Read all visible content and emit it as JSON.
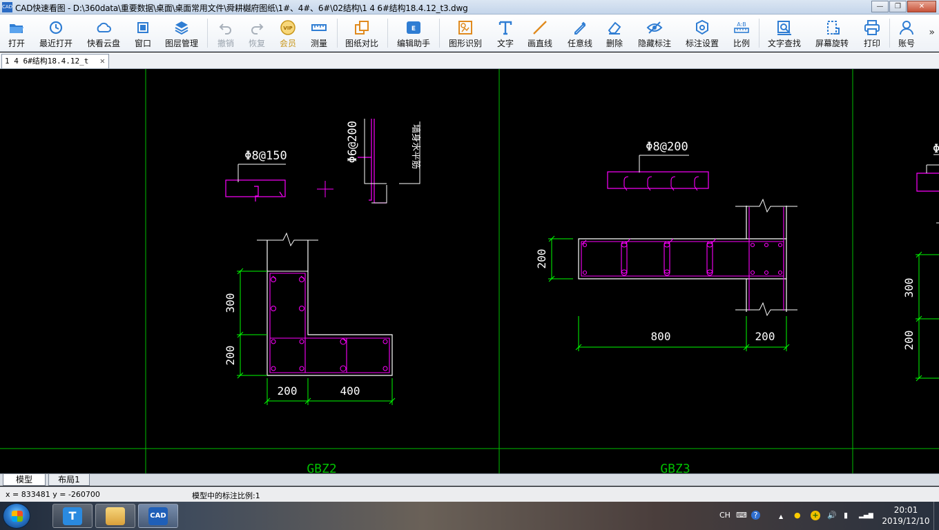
{
  "window": {
    "title": "CAD快速看图 - D:\\360data\\重要数据\\桌面\\桌面常用文件\\舜耕樾府图纸\\1#、4#、6#\\02结构\\1 4 6#结构18.4.12_t3.dwg",
    "icon_text": "CAD",
    "minimize": "—",
    "maximize": "❐",
    "close": "✕"
  },
  "toolbar": {
    "items": [
      {
        "label": "打开",
        "icon": "open-folder-icon",
        "color": "#2f7dd3"
      },
      {
        "label": "最近打开",
        "icon": "recent-history-icon",
        "color": "#2f7dd3"
      },
      {
        "label": "快看云盘",
        "icon": "cloud-icon",
        "color": "#2f7dd3"
      },
      {
        "label": "窗口",
        "icon": "window-icon",
        "color": "#2f7dd3"
      },
      {
        "label": "图层管理",
        "icon": "layers-icon",
        "color": "#2f7dd3"
      },
      {
        "label": "撤销",
        "icon": "undo-icon",
        "color": "#a8b0ba"
      },
      {
        "label": "恢复",
        "icon": "redo-icon",
        "color": "#a8b0ba"
      },
      {
        "label": "会员",
        "icon": "vip-icon",
        "color": "#c8961a"
      },
      {
        "label": "测量",
        "icon": "measure-icon",
        "color": "#2f7dd3"
      },
      {
        "label": "图纸对比",
        "icon": "compare-icon",
        "color": "#e08a1e"
      },
      {
        "label": "编辑助手",
        "icon": "edit-assistant-icon",
        "color": "#2f7dd3"
      },
      {
        "label": "图形识别",
        "icon": "shape-recognition-icon",
        "color": "#e08a1e"
      },
      {
        "label": "文字",
        "icon": "text-icon",
        "color": "#2f7dd3"
      },
      {
        "label": "画直线",
        "icon": "line-icon",
        "color": "#e08a1e"
      },
      {
        "label": "任意线",
        "icon": "freehand-icon",
        "color": "#2f7dd3"
      },
      {
        "label": "删除",
        "icon": "eraser-icon",
        "color": "#2f7dd3"
      },
      {
        "label": "隐藏标注",
        "icon": "hide-annotation-icon",
        "color": "#2f7dd3"
      },
      {
        "label": "标注设置",
        "icon": "annotation-settings-icon",
        "color": "#2f7dd3"
      },
      {
        "label": "比例",
        "icon": "scale-icon",
        "color": "#2f7dd3"
      },
      {
        "label": "文字查找",
        "icon": "text-search-icon",
        "color": "#2f7dd3"
      },
      {
        "label": "屏幕旋转",
        "icon": "screen-rotate-icon",
        "color": "#2f7dd3"
      },
      {
        "label": "打印",
        "icon": "print-icon",
        "color": "#2f7dd3"
      },
      {
        "label": "账号",
        "icon": "account-icon",
        "color": "#2f7dd3"
      }
    ],
    "more": "»"
  },
  "tabs": {
    "document": "1 4 6#结构18.4.12_t",
    "close": "✕"
  },
  "drawing": {
    "colors": {
      "frame": "#00c000",
      "dimension": "#00ff00",
      "outline": "#ffffff",
      "rebar": "#ff00ff"
    },
    "texts": {
      "gbz2_rebar": "Φ8@150",
      "tie_rebar": "Φ6@200",
      "horiz_rebar_note": "墙身水平筋",
      "gbz3_rebar": "Φ8@200",
      "dim_300": "300",
      "dim_200_v": "200",
      "dim_200_h": "200",
      "dim_400": "400",
      "dim_200_gbz3_v": "200",
      "dim_800": "800",
      "dim_200_gbz3_h": "200",
      "right_dim_300": "300",
      "right_dim_200": "200",
      "label_gbz2": "GBZ2",
      "label_gbz3": "GBZ3",
      "right_partial": "Φ"
    }
  },
  "layout_tabs": [
    "模型",
    "布局1"
  ],
  "status": {
    "coords": "x = 833481  y = -260700",
    "scale": "模型中的标注比例:1"
  },
  "taskbar": {
    "apps": [
      {
        "name": "text-app",
        "glyph": "T",
        "color": "#2a8ae0"
      },
      {
        "name": "file-explorer",
        "glyph": "",
        "color": "#e8b84a"
      },
      {
        "name": "cad-viewer",
        "glyph": "CAD",
        "color": "#1f5fb8"
      }
    ],
    "tray": {
      "ime": "CH",
      "keyboard": "⌨",
      "help": "?",
      "expand": "▲",
      "qq": "●",
      "add": "+",
      "volume": "🔊",
      "battery": "▮",
      "signal": "▂▄▆"
    },
    "time": "20:01",
    "date": "2019/12/10"
  }
}
